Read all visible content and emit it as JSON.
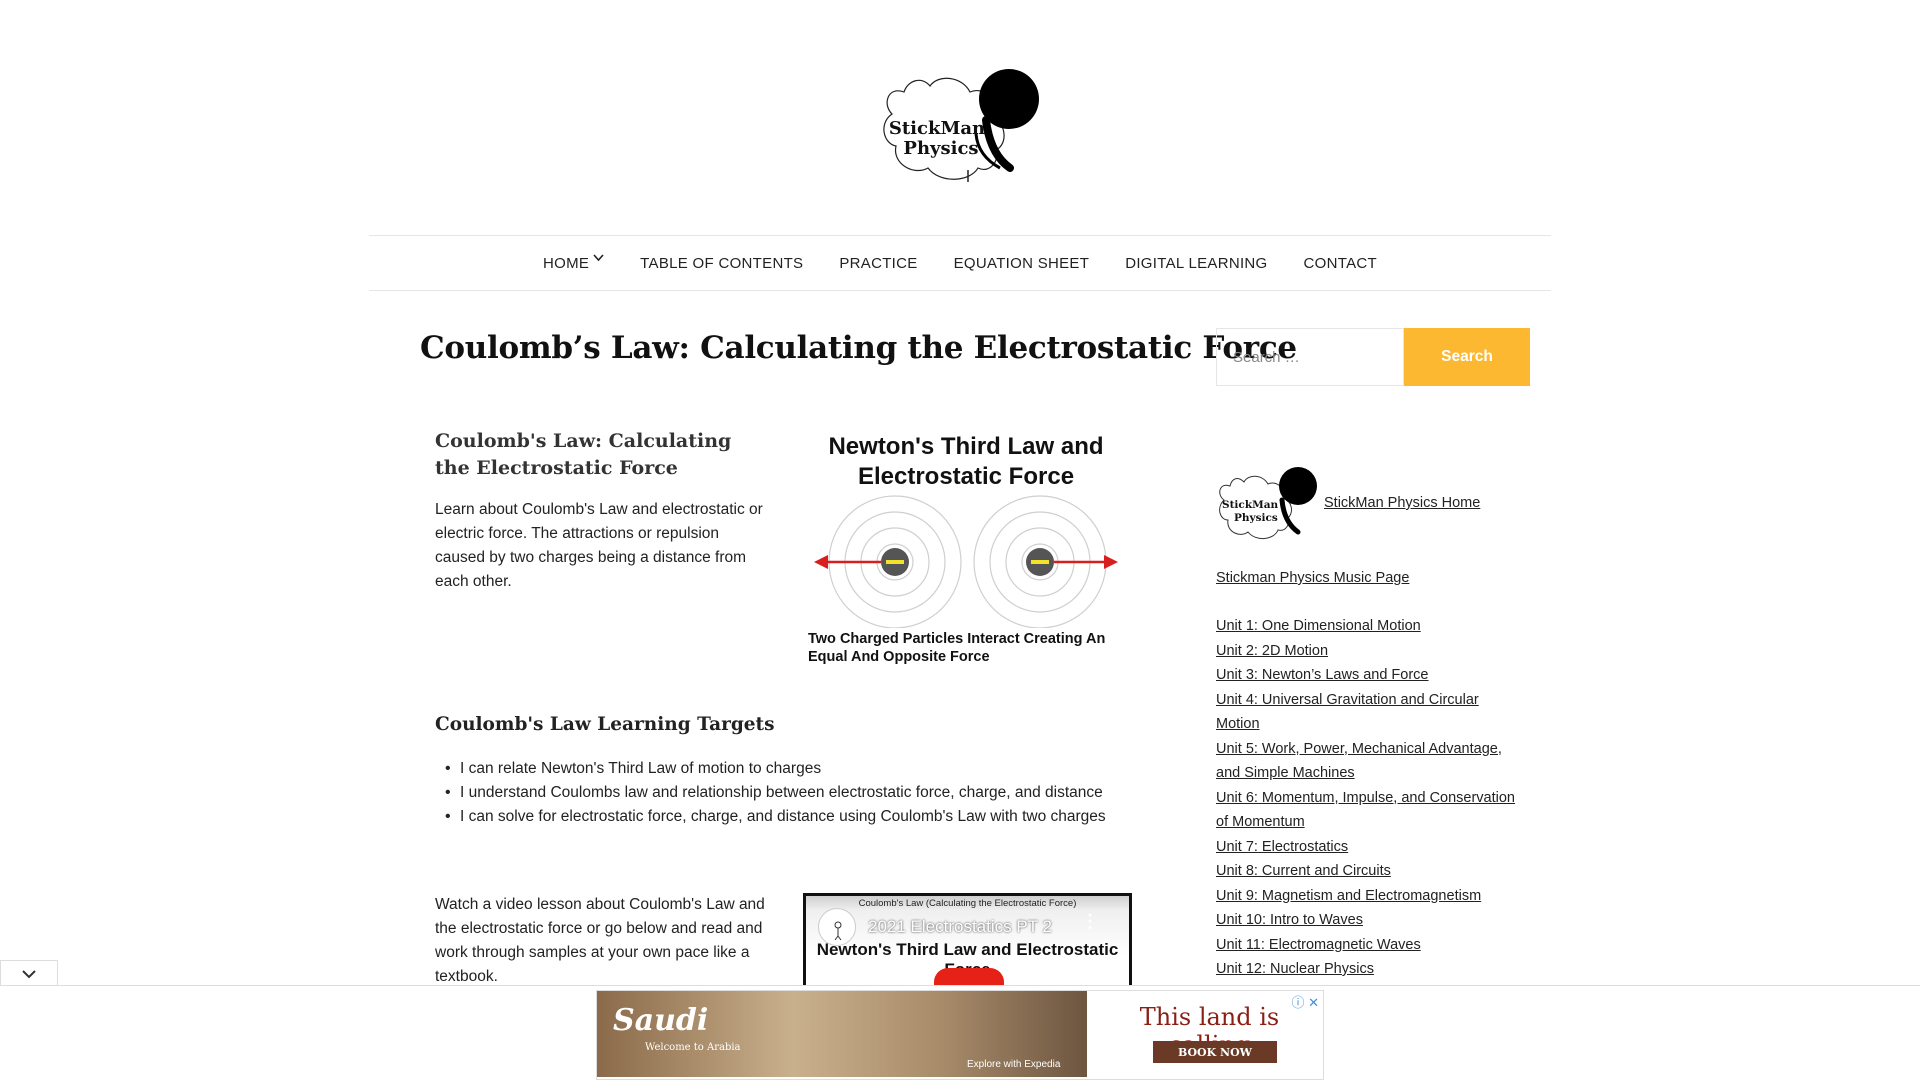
{
  "site": {
    "logo_line1": "StickMan",
    "logo_line2": "Physics"
  },
  "nav": {
    "items": [
      {
        "label": "HOME",
        "has_dropdown": true
      },
      {
        "label": "TABLE OF CONTENTS"
      },
      {
        "label": "PRACTICE"
      },
      {
        "label": "EQUATION SHEET"
      },
      {
        "label": "DIGITAL LEARNING"
      },
      {
        "label": "CONTACT"
      }
    ]
  },
  "post": {
    "title": "Coulomb’s Law: Calculating the Electrostatic Force",
    "intro_heading": "Coulomb's Law: Calculating the Electrostatic Force",
    "intro_text": "Learn about Coulomb's Law and electrostatic or electric force. The attractions or repulsion caused by two charges being a distance from each other.",
    "figure": {
      "title": "Newton's Third Law and Electrostatic Force",
      "caption": "Two Charged Particles Interact Creating An Equal And Opposite Force"
    },
    "targets_heading": "Coulomb's Law Learning Targets",
    "targets": [
      "I can relate Newton's Third Law of motion to charges",
      "I understand Coulombs law and relationship between electrostatic force, charge, and distance",
      "I can solve for electrostatic force, charge, and distance using Coulomb's Law with two charges"
    ],
    "video_text": "Watch a video lesson about Coulomb's Law and the electrostatic force or go below and read and work through samples at your own pace like a textbook.",
    "video": {
      "small_title": "Coulomb's Law (Calculating the Electrostatic Force)",
      "channel_title": "2021 Electrostatics PT 2",
      "heading": "Newton's Third Law and Electrostatic Force"
    }
  },
  "sidebar": {
    "search_placeholder": "Search …",
    "search_button": "Search",
    "home_link": "StickMan Physics Home",
    "music_link": "Stickman Physics Music Page",
    "units": [
      "Unit 1: One Dimensional Motion",
      "Unit 2: 2D Motion",
      "Unit 3: Newton’s Laws and Force",
      "Unit 4: Universal Gravitation and Circular Motion",
      "Unit 5: Work, Power, Mechanical Advantage, and Simple Machines",
      "Unit 6: Momentum, Impulse, and Conservation of Momentum",
      "Unit 7: Electrostatics",
      "Unit 8: Current and Circuits",
      "Unit 9: Magnetism and Electromagnetism",
      "Unit 10: Intro to Waves",
      "Unit 11: Electromagnetic Waves",
      "Unit 12: Nuclear Physics"
    ]
  },
  "ad": {
    "brand": "Saudi",
    "welcome": "Welcome to Arabia",
    "partner": "Explore with Expedia",
    "tagline": "This land is calling",
    "cta": "BOOK NOW",
    "accent": "#fbb830"
  }
}
